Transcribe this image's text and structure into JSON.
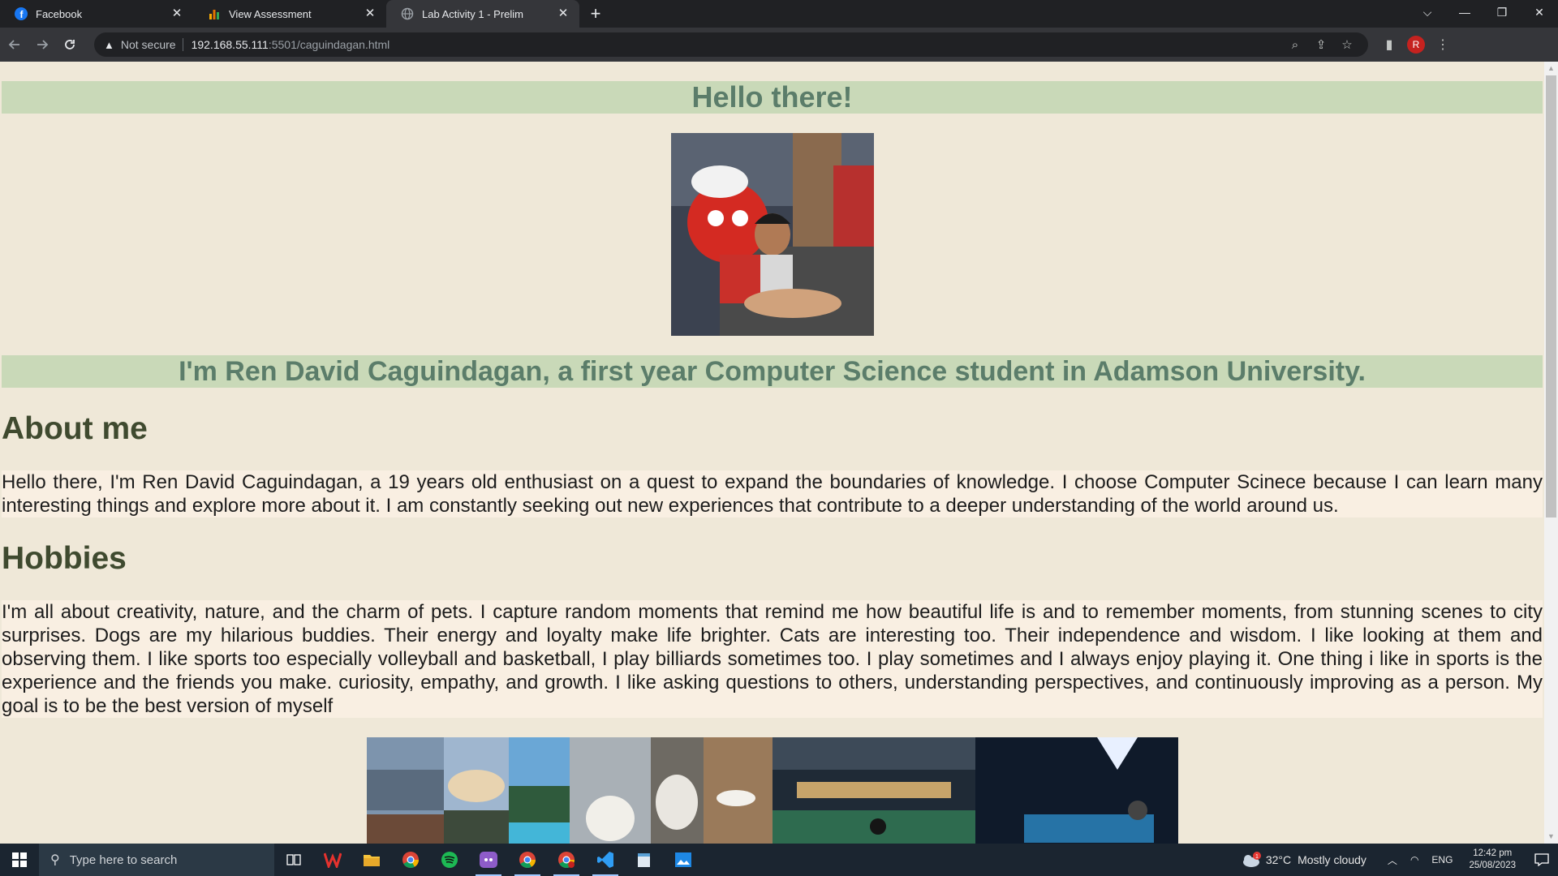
{
  "tabs": [
    {
      "title": "Facebook",
      "icon": "facebook-icon"
    },
    {
      "title": "View Assessment",
      "icon": "bar-chart-icon"
    },
    {
      "title": "Lab Activity 1 - Prelim",
      "icon": "globe-icon"
    }
  ],
  "address_bar": {
    "security_label": "Not secure",
    "host": "192.168.55.111",
    "path": ":5501/caguindagan.html"
  },
  "profile_initial": "R",
  "page": {
    "greeting": "Hello there!",
    "intro": "I'm Ren David Caguindagan, a first year Computer Science student in Adamson University.",
    "about_heading": "About me",
    "about_text": "Hello there, I'm Ren David Caguindagan, a 19 years old enthusiast on a quest to expand the boundaries of knowledge. I choose Computer Scinece because I can learn many interesting things and explore more about it. I am constantly seeking out new experiences that contribute to a deeper understanding of the world around us.",
    "hobbies_heading": "Hobbies",
    "hobbies_text": "I'm all about creativity, nature, and the charm of pets. I capture random moments that remind me how beautiful life is and to remember moments, from stunning scenes to city surprises. Dogs are my hilarious buddies. Their energy and loyalty make life brighter. Cats are interesting too. Their independence and wisdom. I like looking at them and observing them. I like sports too especially volleyball and basketball, I play billiards sometimes too. I play sometimes and I always enjoy playing it. One thing i like in sports is the experience and the friends you make. curiosity, empathy, and growth. I like asking questions to others, understanding perspectives, and continuously improving as a person. My goal is to be the best version of myself"
  },
  "taskbar": {
    "search_placeholder": "Type here to search",
    "temperature": "32°C",
    "weather": "Mostly cloudy",
    "language": "ENG",
    "time": "12:42 pm",
    "date": "25/08/2023",
    "weather_badge": "1"
  }
}
